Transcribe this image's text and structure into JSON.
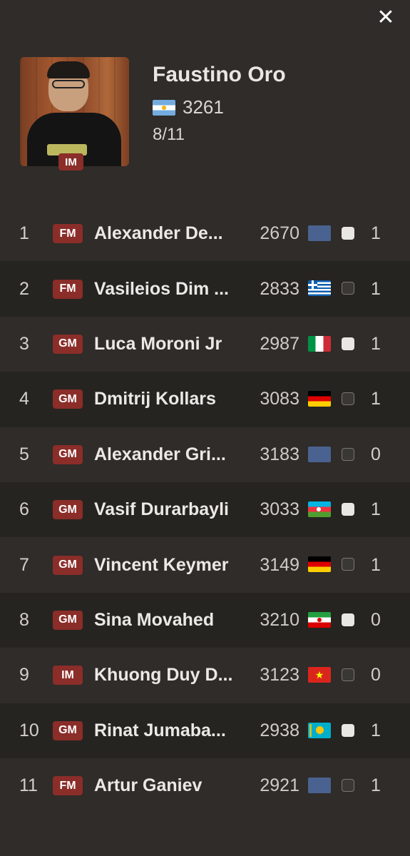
{
  "close_label": "✕",
  "player": {
    "name": "Faustino Oro",
    "title": "IM",
    "flag": "ar",
    "rating": "3261",
    "score": "8/11"
  },
  "colors": {
    "background": "#2f2c29",
    "row_alt": "#262421",
    "title_badge": "#8b2d29"
  },
  "opponents": [
    {
      "rank": "1",
      "title": "FM",
      "name": "Alexander De...",
      "rating": "2670",
      "flag": "none",
      "color": "white",
      "result": "1"
    },
    {
      "rank": "2",
      "title": "FM",
      "name": "Vasileios Dim ...",
      "rating": "2833",
      "flag": "gr",
      "color": "black",
      "result": "1"
    },
    {
      "rank": "3",
      "title": "GM",
      "name": "Luca Moroni Jr",
      "rating": "2987",
      "flag": "it",
      "color": "white",
      "result": "1"
    },
    {
      "rank": "4",
      "title": "GM",
      "name": "Dmitrij Kollars",
      "rating": "3083",
      "flag": "de",
      "color": "black",
      "result": "1"
    },
    {
      "rank": "5",
      "title": "GM",
      "name": "Alexander Gri...",
      "rating": "3183",
      "flag": "none",
      "color": "black",
      "result": "0"
    },
    {
      "rank": "6",
      "title": "GM",
      "name": "Vasif Durarbayli",
      "rating": "3033",
      "flag": "az",
      "color": "white",
      "result": "1"
    },
    {
      "rank": "7",
      "title": "GM",
      "name": "Vincent Keymer",
      "rating": "3149",
      "flag": "de",
      "color": "black",
      "result": "1"
    },
    {
      "rank": "8",
      "title": "GM",
      "name": "Sina Movahed",
      "rating": "3210",
      "flag": "ir",
      "color": "white",
      "result": "0"
    },
    {
      "rank": "9",
      "title": "IM",
      "name": "Khuong Duy D...",
      "rating": "3123",
      "flag": "vn",
      "color": "black",
      "result": "0"
    },
    {
      "rank": "10",
      "title": "GM",
      "name": "Rinat Jumaba...",
      "rating": "2938",
      "flag": "kz",
      "color": "white",
      "result": "1"
    },
    {
      "rank": "11",
      "title": "FM",
      "name": "Artur Ganiev",
      "rating": "2921",
      "flag": "none",
      "color": "black",
      "result": "1"
    }
  ]
}
